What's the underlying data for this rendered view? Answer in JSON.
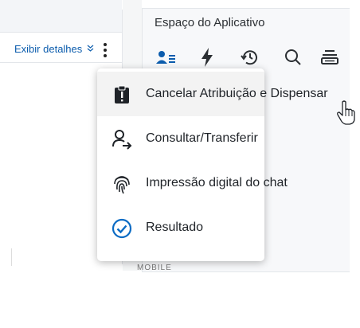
{
  "left_panel": {
    "details_link": "Exibir detalhes",
    "details_chevron": "≫"
  },
  "right_panel": {
    "title": "Espaço do Aplicativo",
    "toolbar_icons": [
      "user-list-icon",
      "bolt-icon",
      "history-icon",
      "search-icon",
      "stack-icon"
    ],
    "bottom_label": "MOBILE"
  },
  "menu": {
    "items": [
      {
        "label": "Cancelar Atribuição e Dispensar",
        "icon": "clipboard-alert-icon"
      },
      {
        "label": "Consultar/Transferir",
        "icon": "user-transfer-icon"
      },
      {
        "label": "Impressão digital do chat",
        "icon": "fingerprint-icon"
      },
      {
        "label": "Resultado",
        "icon": "check-circle-icon"
      }
    ]
  },
  "colors": {
    "accent": "#0b5cad",
    "check": "#0a6bc4",
    "text": "#1f2328"
  }
}
